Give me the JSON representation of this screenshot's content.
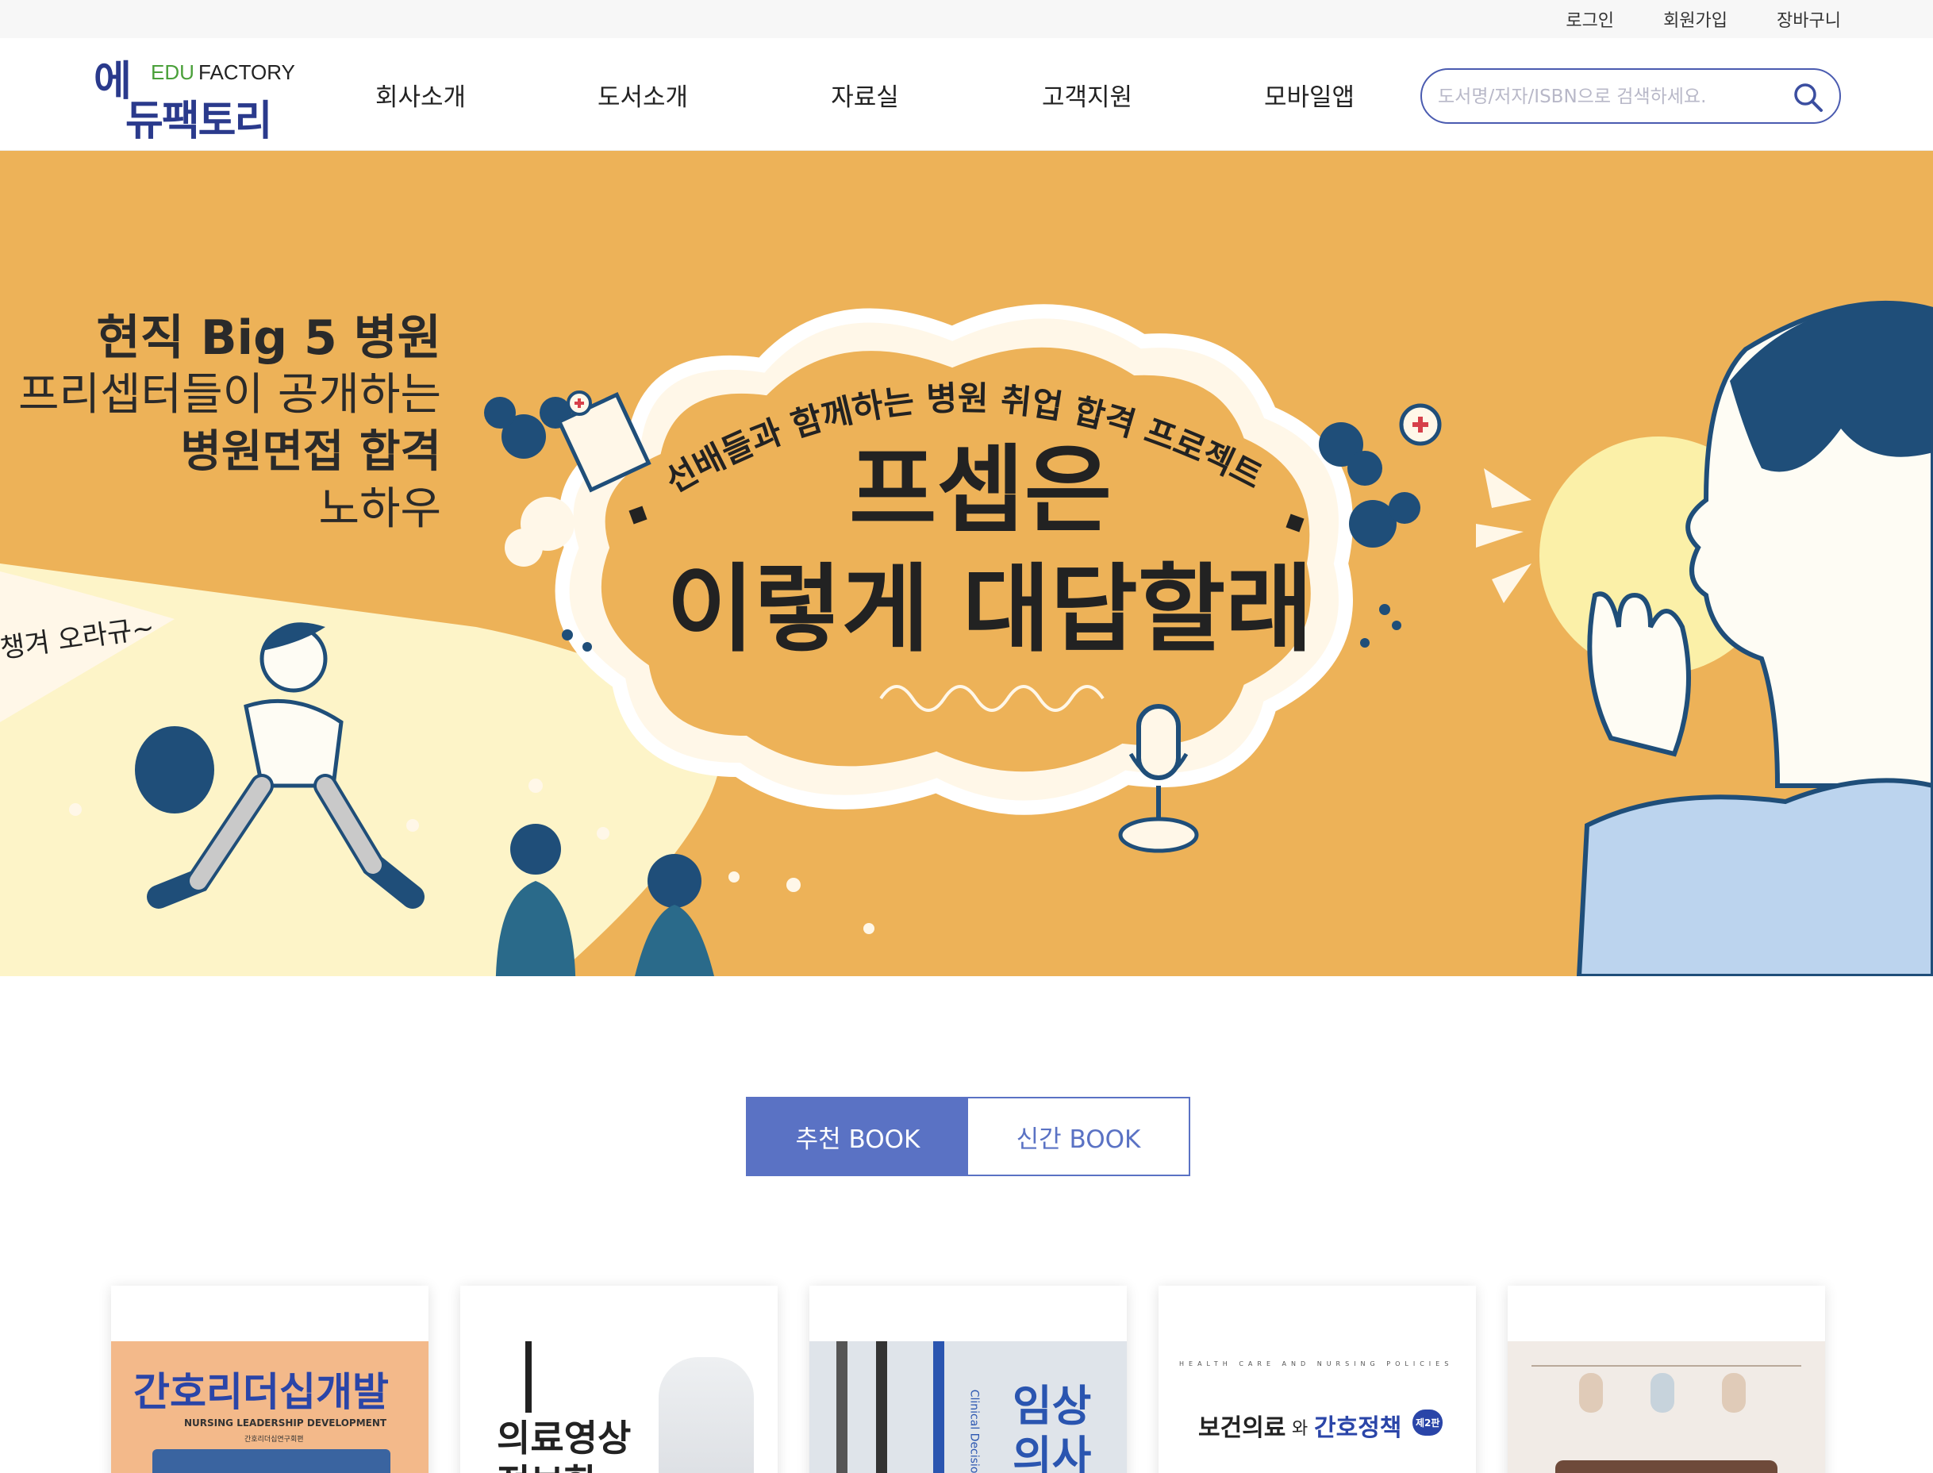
{
  "util_links": [
    "로그인",
    "회원가입",
    "장바구니"
  ],
  "logo": {
    "ko_line1": "에",
    "ko_line2": "듀팩토리",
    "edu": "EDU",
    "factory": "FACTORY"
  },
  "nav": [
    "회사소개",
    "도서소개",
    "자료실",
    "고객지원",
    "모바일앱"
  ],
  "search": {
    "placeholder": "도서명/저자/ISBN으로 검색하세요.",
    "icon": "search-icon"
  },
  "hero": {
    "left_line1": "현직 Big 5 병원",
    "left_line2": "프리셉터들이 공개하는",
    "left_line3": "병원면접 합격",
    "left_line4": "노하우",
    "flag_text": "챙겨 오라규~",
    "arc_text": "선배들과 함께하는 병원 취업 합격 프로젝트",
    "title_line1": "프셉은",
    "title_line2": "이렇게 대답할래",
    "colors": {
      "background": "#edb258",
      "navy": "#1f4e79",
      "cream": "#fdf4c8"
    }
  },
  "carousel": {
    "active_index": 1,
    "count": 2
  },
  "book_tabs": {
    "recommended": "추천 BOOK",
    "new": "신간 BOOK",
    "active": "recommended",
    "accent": "#5a72c4"
  },
  "books": [
    {
      "title": "간호리더십개발",
      "subtitle": "NURSING LEADERSHIP DEVELOPMENT",
      "author": "간호리더십연구회편"
    },
    {
      "title": "의료영상 정보학"
    },
    {
      "title": "임상 의사",
      "spine": "Clinical Decision"
    },
    {
      "title_a": "보건의료",
      "title_b": "와",
      "title_c": "간호정책",
      "edition": "제2판",
      "top_line": "HEALTH CARE AND NURSING POLICIES"
    },
    {
      "title": ""
    }
  ]
}
